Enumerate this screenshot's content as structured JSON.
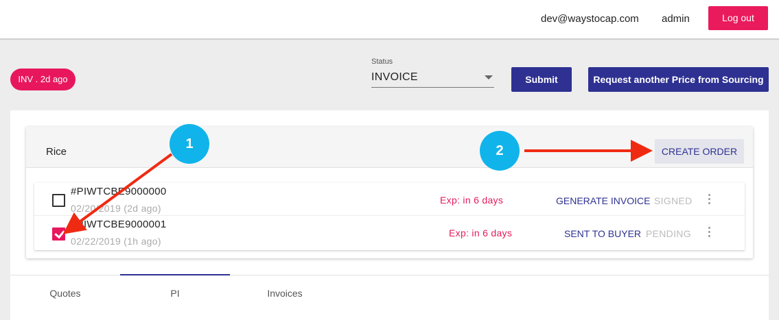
{
  "header": {
    "email": "dev@waystocap.com",
    "role": "admin",
    "logout_label": "Log out"
  },
  "badge": {
    "label": "INV . 2d ago"
  },
  "status": {
    "label": "Status",
    "value": "INVOICE"
  },
  "actions": {
    "submit_label": "Submit",
    "request_label": "Request another Price from Sourcing"
  },
  "card": {
    "title": "Rice",
    "create_order_label": "CREATE ORDER"
  },
  "rows": [
    {
      "code": "#PIWTCBE9000000",
      "date": "02/20/2019 (2d ago)",
      "expiry": "Exp: in 6 days",
      "action": "GENERATE INVOICE",
      "state": "SIGNED",
      "checked": false
    },
    {
      "code": "#PIWTCBE9000001",
      "date": "02/22/2019 (1h ago)",
      "expiry": "Exp: in 6 days",
      "action": "SENT TO BUYER",
      "state": "PENDING",
      "checked": true
    }
  ],
  "tabs": [
    {
      "label": "Quotes"
    },
    {
      "label": "PI",
      "active": true
    },
    {
      "label": "Invoices"
    }
  ],
  "annotations": {
    "step1": "1",
    "step2": "2"
  },
  "colors": {
    "accent": "#e8175d",
    "primary": "#2e3191",
    "callout": "#10b4ea",
    "arrow": "#ef2a12"
  }
}
